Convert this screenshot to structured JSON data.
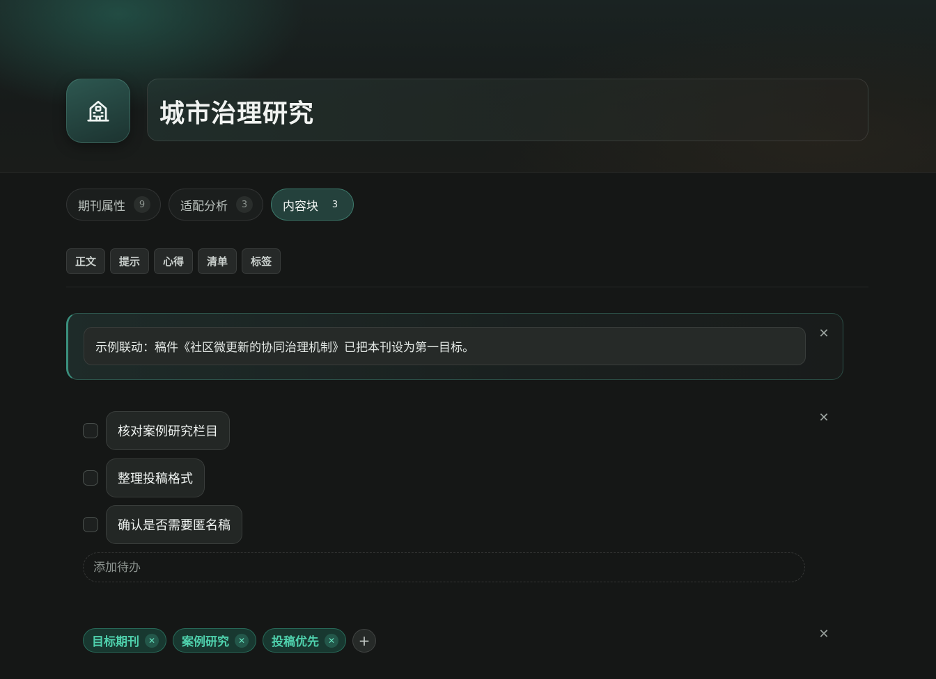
{
  "header": {
    "icon": "building-icon",
    "title": "城市治理研究"
  },
  "tabs": [
    {
      "label": "期刊属性",
      "count": "9",
      "active": false
    },
    {
      "label": "适配分析",
      "count": "3",
      "active": false
    },
    {
      "label": "内容块",
      "count": "3",
      "active": true
    }
  ],
  "block_types": [
    "正文",
    "提示",
    "心得",
    "清单",
    "标签"
  ],
  "callout": {
    "text": "示例联动：稿件《社区微更新的协同治理机制》已把本刊设为第一目标。",
    "close_icon": "close-icon"
  },
  "checklist": {
    "items": [
      {
        "text": "核对案例研究栏目",
        "checked": false
      },
      {
        "text": "整理投稿格式",
        "checked": false
      },
      {
        "text": "确认是否需要匿名稿",
        "checked": false
      }
    ],
    "add_placeholder": "添加待办",
    "close_icon": "close-icon"
  },
  "tags": {
    "items": [
      "目标期刊",
      "案例研究",
      "投稿优先"
    ],
    "remove_icon": "close-icon",
    "add_icon": "plus-icon",
    "close_icon": "close-icon"
  },
  "colors": {
    "accent": "#4fd1ad",
    "active_tab_bg": "#24413c",
    "background": "#151716"
  }
}
